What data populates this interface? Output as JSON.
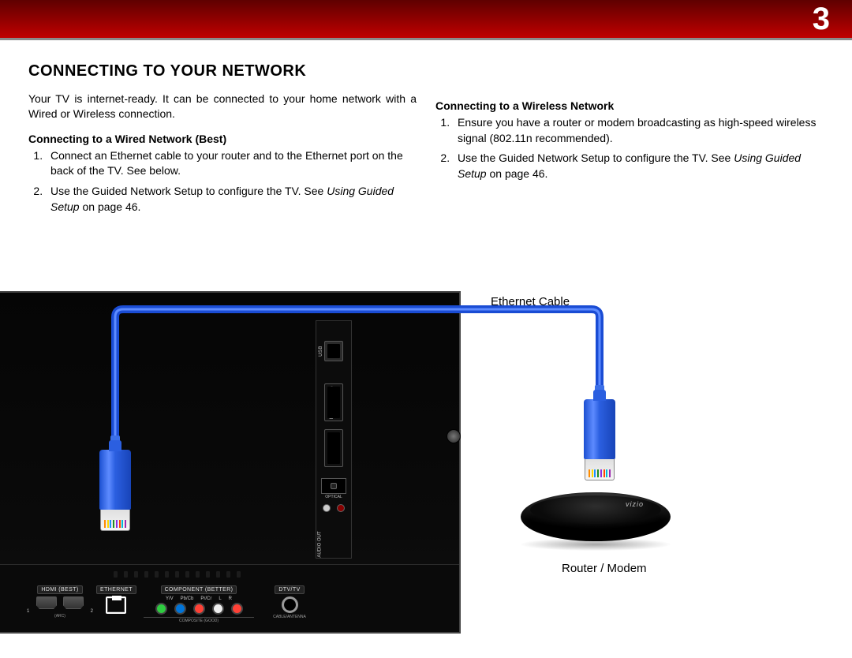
{
  "page_number": "3",
  "title": "CONNECTING TO YOUR NETWORK",
  "intro": "Your TV is internet-ready. It can be connected to your home network with a Wired or Wireless connection.",
  "wired": {
    "heading": "Connecting to a Wired Network (Best)",
    "steps": [
      "Connect an Ethernet cable to your router and to the Ethernet port on the back of the TV. See below.",
      "Use the Guided Network Setup to configure the TV. See "
    ],
    "link_text": "Using Guided Setup",
    "link_suffix": " on page 46."
  },
  "wireless": {
    "heading": "Connecting to a Wireless Network",
    "steps": [
      "Ensure you have a router or modem broadcasting as high-speed wireless signal (802.11n recommended).",
      "Use the Guided Network Setup to configure the TV. See "
    ],
    "link_text": "Using Guided Setup",
    "link_suffix": " on page 46."
  },
  "diagram": {
    "cable_label": "Ethernet Cable",
    "router_label": "Router / Modem",
    "back_panel": {
      "vertical": {
        "usb": "USB",
        "hdmi": "HDMI (BEST)",
        "optical": "OPTICAL",
        "audio_out": "AUDIO OUT"
      },
      "bottom": {
        "hdmi_group": "HDMI (BEST)",
        "hdmi_1": "1",
        "hdmi_2": "2",
        "hdmi_arc": "(ARC)",
        "ethernet": "ETHERNET",
        "component_group": "COMPONENT (BETTER)",
        "yv": "Y/V",
        "pb": "Pb/Cb",
        "pr": "Pr/Cr",
        "l": "L",
        "r": "R",
        "composite": "COMPOSITE (GOOD)",
        "dtv": "DTV/TV",
        "cable_ant": "CABLE/ANTENNA"
      }
    }
  }
}
